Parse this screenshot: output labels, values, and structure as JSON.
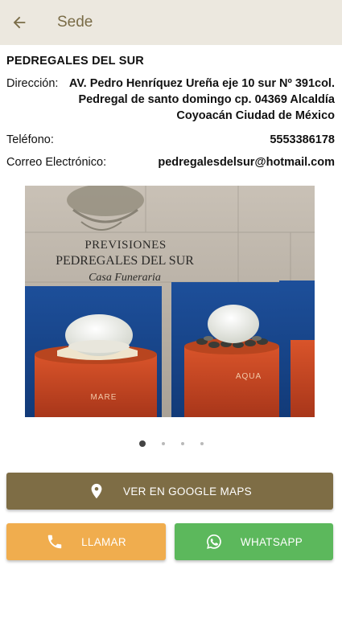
{
  "appbar": {
    "title": "Sede",
    "back_icon": "arrow-left-icon"
  },
  "sede": {
    "name": "PEDREGALES DEL SUR",
    "direccion_label": "Dirección:",
    "direccion_lines": [
      "AV. Pedro Henríquez Ureña eje 10 sur Nº 391col.",
      "Pedregal de santo domingo cp. 04369 Alcaldía",
      "Coyoacán Ciudad de México"
    ],
    "telefono_label": "Teléfono:",
    "telefono": "5553386178",
    "correo_label": "Correo Electrónico:",
    "correo": "pedregalesdelsur@hotmail.com"
  },
  "photo": {
    "sign_line1": "PREVISIONES",
    "sign_line2": "PEDREGALES DEL SUR",
    "sign_line3": "Casa Funeraria",
    "urn_left_label": "MARE",
    "urn_right_label": "AQUA"
  },
  "carousel": {
    "count": 4,
    "active": 0
  },
  "buttons": {
    "maps_label": "VER EN GOOGLE MAPS",
    "maps_icon": "map-pin-icon",
    "call_label": "LLAMAR",
    "call_icon": "phone-icon",
    "whatsapp_label": "WHATSAPP",
    "whatsapp_icon": "whatsapp-icon"
  },
  "colors": {
    "appbar_bg": "#ece8df",
    "title": "#7a6c47",
    "maps_button": "#7e6d45",
    "call_button": "#f0ad4e",
    "whatsapp_button": "#5cb85c"
  }
}
